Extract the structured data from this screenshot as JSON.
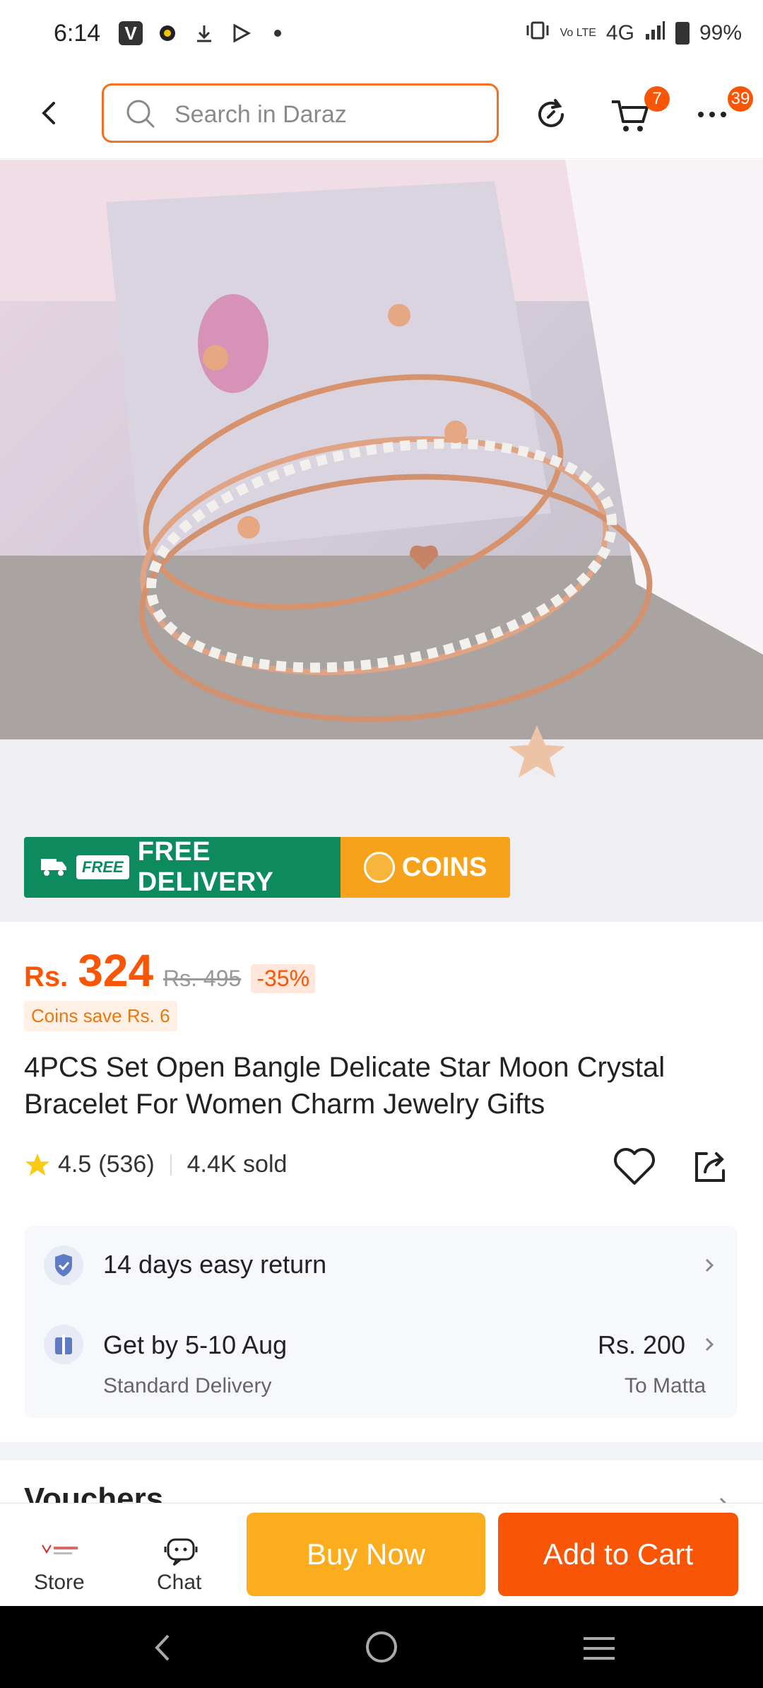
{
  "status_bar": {
    "time": "6:14",
    "network": "4G",
    "battery": "99%",
    "volte": "Vo LTE"
  },
  "header": {
    "search_placeholder": "Search in Daraz",
    "cart_count": "7",
    "notifications_count": "39"
  },
  "banner": {
    "free_tag": "FREE",
    "free_delivery": "FREE DELIVERY",
    "coins": "COINS"
  },
  "product": {
    "currency": "Rs.",
    "price": "324",
    "original_price": "Rs. 495",
    "discount": "-35%",
    "coins_save": "Coins save Rs. 6",
    "title": "4PCS Set Open Bangle Delicate Star Moon Crystal Bracelet For Women Charm Jewelry Gifts",
    "rating": "4.5",
    "reviews": "(536)",
    "sold": "4.4K sold"
  },
  "info": {
    "return": "14 days easy return",
    "delivery_title": "Get by 5-10 Aug",
    "delivery_type": "Standard Delivery",
    "delivery_price": "Rs. 200",
    "delivery_to": "To Matta"
  },
  "vouchers": {
    "title": "Vouchers"
  },
  "bottom_bar": {
    "store_label": "Store",
    "chat_label": "Chat",
    "buy_now": "Buy Now",
    "add_to_cart": "Add to Cart"
  },
  "colors": {
    "brand": "#f85606",
    "buy_now": "#fcad1e",
    "free_delivery": "#0e8a5f",
    "coins": "#f7a21b"
  }
}
